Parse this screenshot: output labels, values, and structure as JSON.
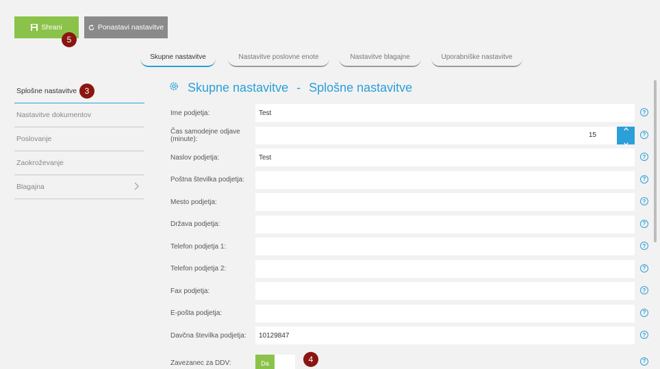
{
  "toolbar": {
    "save_label": "Shrani",
    "reset_label": "Ponastavi nastavitve"
  },
  "tabs": [
    {
      "label": "Skupne nastavitve"
    },
    {
      "label": "Nastavitve poslovne enote"
    },
    {
      "label": "Nastavitve blagajne"
    },
    {
      "label": "Uporabniške nastavitve"
    }
  ],
  "sidebar": {
    "items": [
      {
        "label": "Splošne nastavitve"
      },
      {
        "label": "Nastavitve dokumentov"
      },
      {
        "label": "Poslovanje"
      },
      {
        "label": "Zaokroževanje"
      },
      {
        "label": "Blagajna"
      }
    ]
  },
  "section_title": {
    "part1": "Skupne nastavitve",
    "separator": "-",
    "part2": "Splošne nastavitve"
  },
  "form": {
    "fields": [
      {
        "label": "Ime podjetja:",
        "value": "Test"
      },
      {
        "label": "Čas samodejne odjave (minute):",
        "value": "15"
      },
      {
        "label": "Naslov podjetja:",
        "value": "Test"
      },
      {
        "label": "Poštna številka podjetja:",
        "value": ""
      },
      {
        "label": "Mesto podjetja:",
        "value": ""
      },
      {
        "label": "Država podjetja:",
        "value": ""
      },
      {
        "label": "Telefon podjetja 1:",
        "value": ""
      },
      {
        "label": "Telefon podjetja 2:",
        "value": ""
      },
      {
        "label": "Fax podjetja:",
        "value": ""
      },
      {
        "label": "E-pošta podjetja:",
        "value": ""
      },
      {
        "label": "Davčna številka podjetja:",
        "value": "10129847"
      }
    ],
    "vat": {
      "label": "Zavezanec za DDV:",
      "toggle_label": "Da"
    },
    "help_glyph": "?"
  },
  "badges": {
    "save": "5",
    "sidebar": "3",
    "vat": "4"
  },
  "colors": {
    "accent": "#2a9fd8",
    "save": "#8bc34a",
    "reset": "#8a8a8a",
    "badge": "#8b1510"
  }
}
